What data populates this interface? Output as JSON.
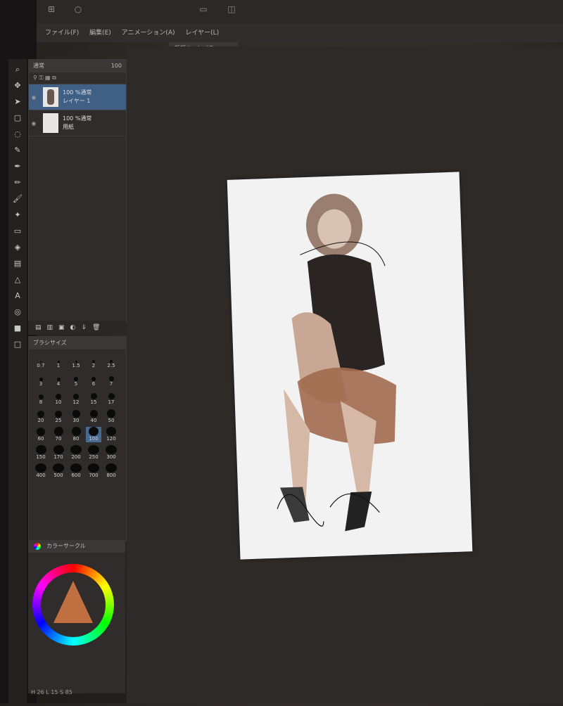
{
  "titlebar": {
    "icons": [
      "windows-logo-icon",
      "circle-icon",
      "window-icon",
      "app-icon"
    ]
  },
  "menu": {
    "items": [
      "ファイル(F)",
      "編集(E)",
      "アニメーション(A)",
      "レイヤー(L)"
    ]
  },
  "document_tab": {
    "label": "新規キャンバス"
  },
  "layer_panel": {
    "blend_mode": "通常",
    "opacity": "100",
    "layers": [
      {
        "opacity_blend": "100 %通常",
        "name": "レイヤー 1",
        "selected": true
      },
      {
        "opacity_blend": "100 %通常",
        "name": "用紙",
        "selected": false
      }
    ]
  },
  "brush_panel": {
    "title": "ブラシサイズ",
    "sizes": [
      "0.7",
      "1",
      "1.5",
      "2",
      "2.5",
      "3",
      "4",
      "5",
      "6",
      "7",
      "8",
      "10",
      "12",
      "15",
      "17",
      "20",
      "25",
      "30",
      "40",
      "50",
      "60",
      "70",
      "80",
      "100",
      "120",
      "150",
      "170",
      "200",
      "250",
      "300",
      "400",
      "500",
      "600",
      "700",
      "800"
    ],
    "selected": "100"
  },
  "color_panel": {
    "title": "カラーサークル"
  },
  "status": {
    "coords": "H 26 L 15 S 85"
  },
  "colors": {
    "accent": "#466a92",
    "panel_bg": "#2f2c2b",
    "canvas_bg": "#f2f2f2"
  }
}
